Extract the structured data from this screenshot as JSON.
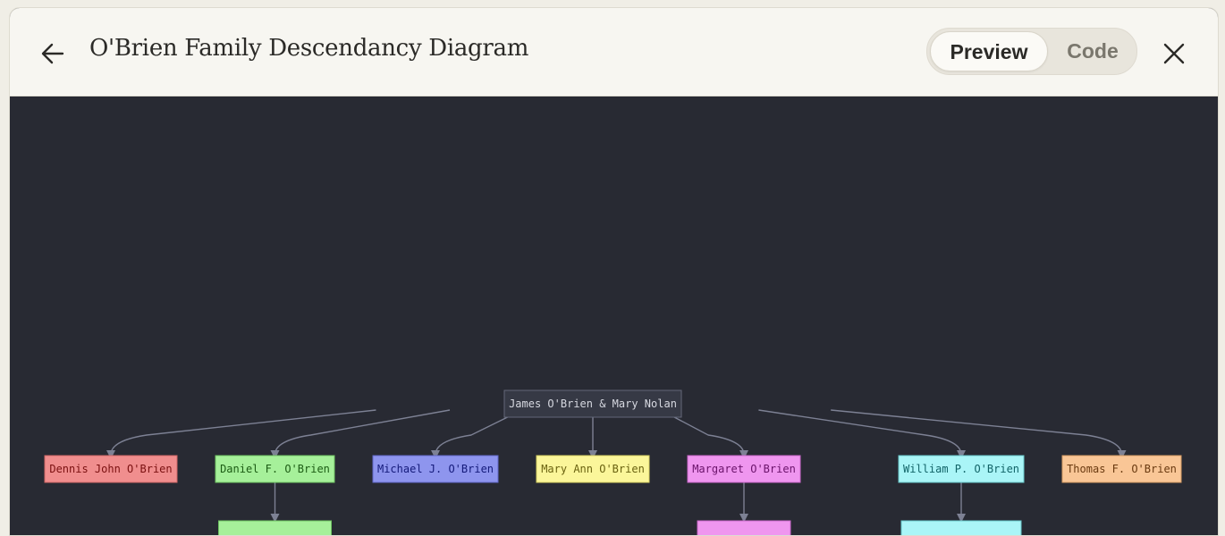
{
  "header": {
    "title": "O'Brien Family Descendancy Diagram",
    "back_icon": "arrow-left-icon",
    "close_icon": "close-icon"
  },
  "view_toggle": {
    "preview_label": "Preview",
    "code_label": "Code",
    "selected": "Preview"
  },
  "diagram": {
    "root": "James O'Brien & Mary Nolan",
    "children": [
      {
        "name": "Dennis John O'Brien",
        "fill": "#f08e8e",
        "stroke": "#d06666",
        "text": "#7a1010"
      },
      {
        "name": "Daniel F. O'Brien",
        "fill": "#a6f09a",
        "stroke": "#6fc462",
        "text": "#1c5c14"
      },
      {
        "name": "Michael J. O'Brien",
        "fill": "#8e95ee",
        "stroke": "#6168c8",
        "text": "#141a7a"
      },
      {
        "name": "Mary Ann O'Brien",
        "fill": "#fbf69a",
        "stroke": "#d4cd60",
        "text": "#6a6210"
      },
      {
        "name": "Margaret O'Brien",
        "fill": "#ef96ef",
        "stroke": "#c866c8",
        "text": "#6a126a"
      },
      {
        "name": "William P. O'Brien",
        "fill": "#aaf5f7",
        "stroke": "#66c6ca",
        "text": "#126468"
      },
      {
        "name": "Thomas F. O'Brien",
        "fill": "#f9c696",
        "stroke": "#d49a62",
        "text": "#6a3a10"
      }
    ],
    "colors": {
      "background": "#282a33",
      "root_fill": "#363945",
      "root_stroke": "#636778",
      "root_text": "#d6d8e0",
      "edge": "#7d8194"
    }
  }
}
